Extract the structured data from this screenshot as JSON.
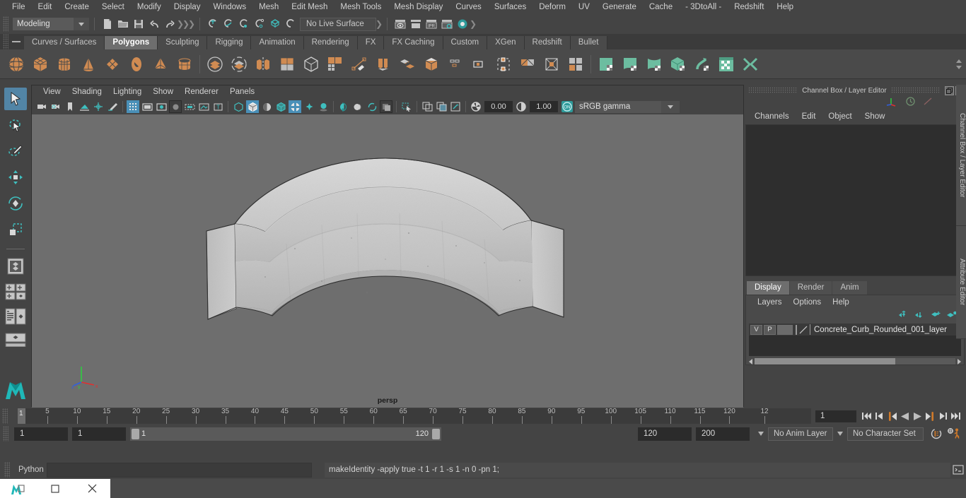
{
  "app": {
    "title": "Autodesk Maya",
    "accent": "#5285a6",
    "orange": "#d08b52",
    "teal": "#4ab3b3"
  },
  "menubar": {
    "items": [
      "File",
      "Edit",
      "Create",
      "Select",
      "Modify",
      "Display",
      "Windows",
      "Mesh",
      "Edit Mesh",
      "Mesh Tools",
      "Mesh Display",
      "Curves",
      "Surfaces",
      "Deform",
      "UV",
      "Generate",
      "Cache",
      "- 3DtoAll -",
      "Redshift",
      "Help"
    ]
  },
  "statusline": {
    "mode": "Modeling",
    "live_surface": "No Live Surface",
    "icons": [
      "new-scene-icon",
      "open-scene-icon",
      "save-scene-icon",
      "undo-icon",
      "redo-icon",
      "select-by-hierarchy-icon",
      "select-by-object-icon",
      "select-by-component-icon",
      "snap-to-grid-icon",
      "snap-to-curve-icon",
      "snap-to-point-icon",
      "snap-to-projected-center-icon",
      "snap-to-view-plane-icon",
      "make-live-icon",
      "render-view-icon",
      "render-region-icon",
      "ipr-render-icon",
      "render-settings-icon",
      "hypershade-icon"
    ]
  },
  "shelf": {
    "tabs": [
      "Curves / Surfaces",
      "Polygons",
      "Sculpting",
      "Rigging",
      "Animation",
      "Rendering",
      "FX",
      "FX Caching",
      "Custom",
      "XGen",
      "Redshift",
      "Bullet"
    ],
    "active_tab": "Polygons",
    "icons": [
      "poly-sphere-icon",
      "poly-cube-icon",
      "poly-cylinder-icon",
      "poly-cone-icon",
      "poly-plane-icon",
      "poly-torus-icon",
      "poly-pyramid-icon",
      "poly-pipe-icon",
      "boolean-union-icon",
      "boolean-difference-icon",
      "mirror-geometry-icon",
      "combine-icon",
      "smooth-icon",
      "multi-cut-icon",
      "extrude-icon",
      "bevel-icon",
      "bridge-icon",
      "append-polygon-icon",
      "wedge-icon",
      "quad-draw-icon",
      "insert-edge-loop-icon",
      "offset-edge-loop-icon",
      "target-weld-icon",
      "merge-vertices-icon",
      "uv-editor-icon",
      "planar-mapping-icon",
      "cylindrical-mapping-icon",
      "automatic-mapping-icon",
      "unfold-icon",
      "uv-snapshot-icon",
      "uv-cut-icon"
    ]
  },
  "viewport": {
    "menus": [
      "View",
      "Shading",
      "Lighting",
      "Show",
      "Renderer",
      "Panels"
    ],
    "exposure": "0.00",
    "gamma_value": "1.00",
    "color_management": "sRGB gamma",
    "color_management_toggle": "ON",
    "camera_label": "persp",
    "axis_labels": [
      "x",
      "y",
      "z"
    ],
    "object_description": "Concrete curved curb 3D model, rounded corner segment, light grey concrete texture"
  },
  "toolbox": {
    "items": [
      "select-tool-icon",
      "lasso-select-tool-icon",
      "paint-select-tool-icon",
      "move-tool-icon",
      "rotate-tool-icon",
      "scale-tool-icon",
      "last-tool-icon",
      "four-view-layout-icon",
      "persp-outliner-layout-icon",
      "persp-graph-layout-icon",
      "single-persp-layout-icon",
      "maya-logo-icon"
    ]
  },
  "channelbox": {
    "title": "Channel Box / Layer Editor",
    "menus": [
      "Channels",
      "Edit",
      "Object",
      "Show"
    ],
    "window_buttons": [
      "restore-icon",
      "close-icon"
    ],
    "top_icons": [
      "axis-gizmo-icon",
      "clock-icon",
      "slash-icon"
    ]
  },
  "layereditor": {
    "tabs": [
      "Display",
      "Render",
      "Anim"
    ],
    "active_tab": "Display",
    "menus": [
      "Layers",
      "Options",
      "Help"
    ],
    "buttons": [
      "move-layer-up-icon",
      "move-layer-down-icon",
      "new-layer-icon",
      "new-layer-from-selected-icon"
    ],
    "layers": [
      {
        "visibility": "V",
        "playback": "P",
        "shading": "",
        "name": "Concrete_Curb_Rounded_001_layer"
      }
    ]
  },
  "vertical_tabs": [
    "Channel Box / Layer Editor",
    "Attribute Editor"
  ],
  "timeslider": {
    "ticks": [
      5,
      10,
      15,
      20,
      25,
      30,
      35,
      40,
      45,
      50,
      55,
      60,
      65,
      70,
      75,
      80,
      85,
      90,
      95,
      100,
      105,
      110,
      115,
      120
    ],
    "start_label": "1",
    "end_partial_label": "12",
    "current_frame": "1",
    "playback_buttons": [
      "go-to-start-icon",
      "step-back-keyframe-icon",
      "step-back-frame-icon",
      "play-backwards-icon",
      "play-forwards-icon",
      "step-forward-frame-icon",
      "step-forward-keyframe-icon",
      "go-to-end-icon"
    ]
  },
  "rangeslider": {
    "anim_start": "1",
    "playback_start": "1",
    "range_left_label": "1",
    "range_right_label": "120",
    "playback_end": "120",
    "anim_end": "200",
    "anim_layer": "No Anim Layer",
    "character_set": "No Character Set",
    "right_icons": [
      "auto-keyframe-icon",
      "animation-preferences-icon"
    ]
  },
  "commandline": {
    "language": "Python",
    "input_value": "",
    "output": "makeIdentity -apply true -t 1 -r 1 -s 1 -n 0 -pn 1;",
    "script-editor-icon": "script-editor-icon"
  },
  "taskbar": {
    "window_controls": [
      "maya-app-icon",
      "maximize-icon",
      "close-icon"
    ]
  }
}
